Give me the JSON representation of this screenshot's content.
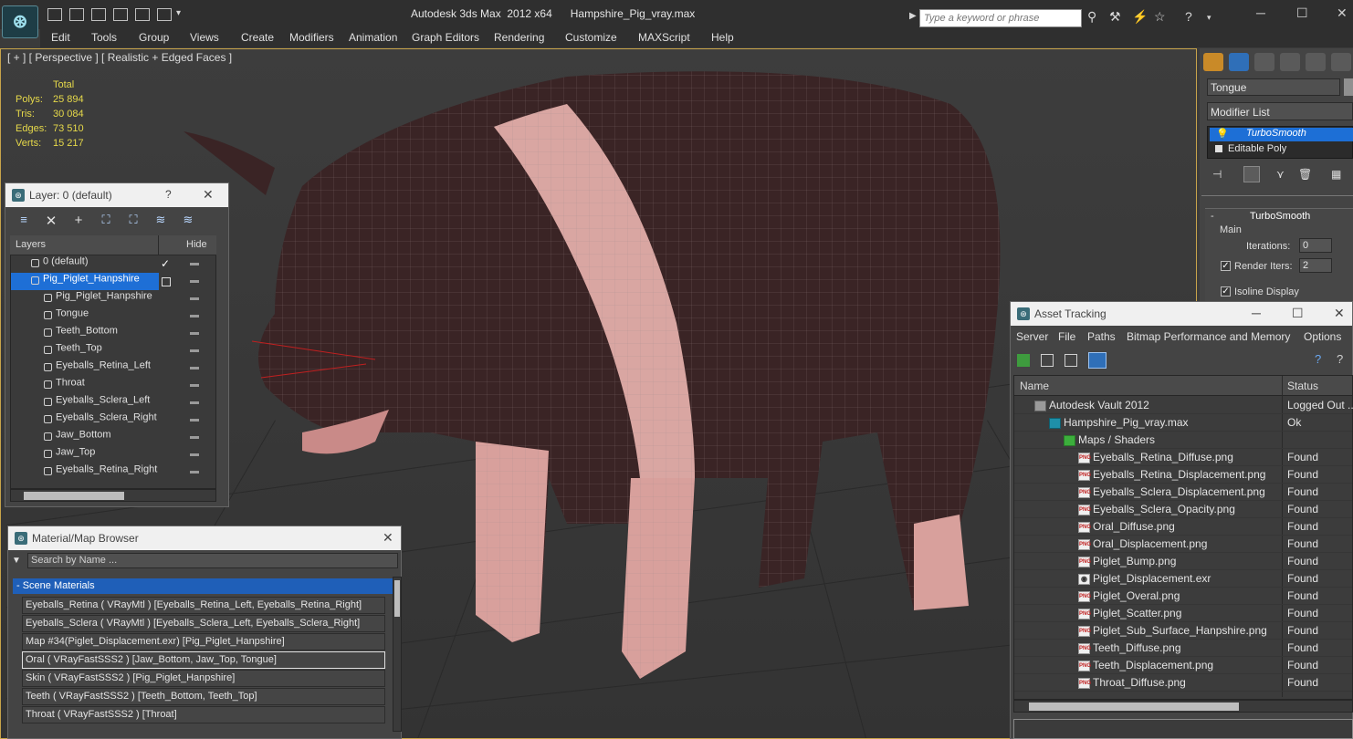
{
  "window": {
    "title": "Autodesk 3ds Max  2012 x64      Hampshire_Pig_vray.max",
    "search_placeholder": "Type a keyword or phrase"
  },
  "menu": [
    "Edit",
    "Tools",
    "Group",
    "Views",
    "Create",
    "Modifiers",
    "Animation",
    "Graph Editors",
    "Rendering",
    "Customize",
    "MAXScript",
    "Help"
  ],
  "viewport": {
    "label": "[ + ] [ Perspective ] [ Realistic + Edged Faces ]",
    "stats": {
      "total_label": "Total",
      "rows": [
        {
          "label": "Polys:",
          "value": "25 894"
        },
        {
          "label": "Tris:",
          "value": "30 084"
        },
        {
          "label": "Edges:",
          "value": "73 510"
        },
        {
          "label": "Verts:",
          "value": "15 217"
        }
      ]
    }
  },
  "command_panel": {
    "object_name": "Tongue",
    "modifier_list": "Modifier List",
    "stack": [
      "TurboSmooth",
      "Editable Poly"
    ],
    "rollout_title": "TurboSmooth",
    "main_label": "Main",
    "iterations_label": "Iterations:",
    "iterations_value": "0",
    "render_iters_label": "Render Iters:",
    "render_iters_value": "2",
    "isoline_label": "Isoline Display",
    "colors": {
      "selection": "#1d6fd6",
      "viewport_border": "#c8a44a"
    }
  },
  "layer_dialog": {
    "title": "Layer: 0 (default)",
    "help": "?",
    "col_layers": "Layers",
    "col_hide": "Hide",
    "rows": [
      {
        "name": "0 (default)",
        "level": 0
      },
      {
        "name": "Pig_Piglet_Hanpshire",
        "level": 0,
        "selected": true
      },
      {
        "name": "Pig_Piglet_Hanpshire",
        "level": 1
      },
      {
        "name": "Tongue",
        "level": 1
      },
      {
        "name": "Teeth_Bottom",
        "level": 1
      },
      {
        "name": "Teeth_Top",
        "level": 1
      },
      {
        "name": "Eyeballs_Retina_Left",
        "level": 1
      },
      {
        "name": "Throat",
        "level": 1
      },
      {
        "name": "Eyeballs_Sclera_Left",
        "level": 1
      },
      {
        "name": "Eyeballs_Sclera_Right",
        "level": 1
      },
      {
        "name": "Jaw_Bottom",
        "level": 1
      },
      {
        "name": "Jaw_Top",
        "level": 1
      },
      {
        "name": "Eyeballs_Retina_Right",
        "level": 1
      }
    ]
  },
  "material_browser": {
    "title": "Material/Map Browser",
    "search_placeholder": "Search by Name ...",
    "section": "- Scene Materials",
    "rows": [
      "Eyeballs_Retina  ( VRayMtl ) [Eyeballs_Retina_Left, Eyeballs_Retina_Right]",
      "Eyeballs_Sclera  ( VRayMtl ) [Eyeballs_Sclera_Left, Eyeballs_Sclera_Right]",
      "Map #34(Piglet_Displacement.exr) [Pig_Piglet_Hanpshire]",
      "Oral  ( VRayFastSSS2 ) [Jaw_Bottom, Jaw_Top, Tongue]",
      "Skin  ( VRayFastSSS2 ) [Pig_Piglet_Hanpshire]",
      "Teeth  ( VRayFastSSS2 ) [Teeth_Bottom, Teeth_Top]",
      "Throat  ( VRayFastSSS2 ) [Throat]"
    ]
  },
  "asset_tracking": {
    "title": "Asset Tracking",
    "menu": [
      "Server",
      "File",
      "Paths",
      "Bitmap Performance and Memory",
      "Options"
    ],
    "col_name": "Name",
    "col_status": "Status",
    "rows": [
      {
        "name": "Autodesk Vault 2012",
        "status": "Logged Out ...",
        "icon": "vault",
        "indent": 0
      },
      {
        "name": "Hampshire_Pig_vray.max",
        "status": "Ok",
        "icon": "max",
        "indent": 1
      },
      {
        "name": "Maps / Shaders",
        "status": "",
        "icon": "folder",
        "indent": 2
      },
      {
        "name": "Eyeballs_Retina_Diffuse.png",
        "status": "Found",
        "icon": "png",
        "indent": 3
      },
      {
        "name": "Eyeballs_Retina_Displacement.png",
        "status": "Found",
        "icon": "png",
        "indent": 3
      },
      {
        "name": "Eyeballs_Sclera_Displacement.png",
        "status": "Found",
        "icon": "png",
        "indent": 3
      },
      {
        "name": "Eyeballs_Sclera_Opacity.png",
        "status": "Found",
        "icon": "png",
        "indent": 3
      },
      {
        "name": "Oral_Diffuse.png",
        "status": "Found",
        "icon": "png",
        "indent": 3
      },
      {
        "name": "Oral_Displacement.png",
        "status": "Found",
        "icon": "png",
        "indent": 3
      },
      {
        "name": "Piglet_Bump.png",
        "status": "Found",
        "icon": "png",
        "indent": 3
      },
      {
        "name": "Piglet_Displacement.exr",
        "status": "Found",
        "icon": "exr",
        "indent": 3
      },
      {
        "name": "Piglet_Overal.png",
        "status": "Found",
        "icon": "png",
        "indent": 3
      },
      {
        "name": "Piglet_Scatter.png",
        "status": "Found",
        "icon": "png",
        "indent": 3
      },
      {
        "name": "Piglet_Sub_Surface_Hanpshire.png",
        "status": "Found",
        "icon": "png",
        "indent": 3
      },
      {
        "name": "Teeth_Diffuse.png",
        "status": "Found",
        "icon": "png",
        "indent": 3
      },
      {
        "name": "Teeth_Displacement.png",
        "status": "Found",
        "icon": "png",
        "indent": 3
      },
      {
        "name": "Throat_Diffuse.png",
        "status": "Found",
        "icon": "png",
        "indent": 3
      }
    ]
  }
}
